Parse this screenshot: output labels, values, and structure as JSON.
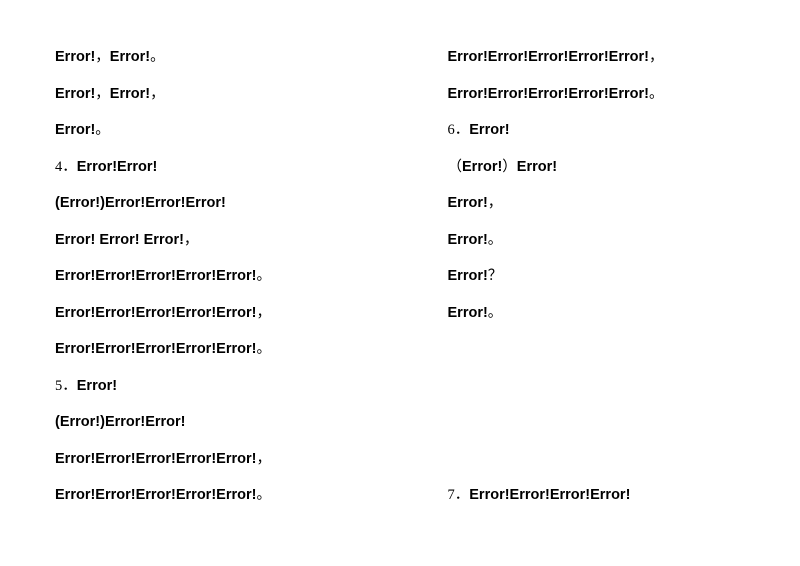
{
  "left": [
    {
      "segments": [
        {
          "t": "Error!",
          "b": true
        },
        {
          "t": "，",
          "b": false
        },
        {
          "t": "Error!",
          "b": true
        },
        {
          "t": "。",
          "b": false
        }
      ]
    },
    {
      "segments": [
        {
          "t": "Error!",
          "b": true
        },
        {
          "t": "，",
          "b": false
        },
        {
          "t": "Error!",
          "b": true
        },
        {
          "t": "，",
          "b": false
        }
      ]
    },
    {
      "segments": [
        {
          "t": "Error!",
          "b": true
        },
        {
          "t": "。",
          "b": false
        }
      ]
    },
    {
      "segments": [
        {
          "t": "4．",
          "b": false,
          "num": true
        },
        {
          "t": "Error!Error!",
          "b": true
        }
      ]
    },
    {
      "segments": [
        {
          "t": "(Error!)Error!Error!Error!",
          "b": true
        }
      ]
    },
    {
      "segments": [
        {
          "t": "Error!  Error!  Error!",
          "b": true
        },
        {
          "t": "，",
          "b": false
        }
      ]
    },
    {
      "segments": [
        {
          "t": "Error!Error!Error!Error!Error!",
          "b": true
        },
        {
          "t": "。",
          "b": false
        }
      ]
    },
    {
      "segments": [
        {
          "t": "Error!Error!Error!Error!Error!",
          "b": true
        },
        {
          "t": "，",
          "b": false
        }
      ]
    },
    {
      "segments": [
        {
          "t": "Error!Error!Error!Error!Error!",
          "b": true
        },
        {
          "t": "。",
          "b": false
        }
      ]
    },
    {
      "segments": [
        {
          "t": "5．",
          "b": false,
          "num": true
        },
        {
          "t": "Error!",
          "b": true
        }
      ]
    },
    {
      "segments": [
        {
          "t": "(Error!)Error!Error!",
          "b": true
        }
      ]
    },
    {
      "segments": [
        {
          "t": "Error!Error!Error!Error!Error!",
          "b": true
        },
        {
          "t": "，",
          "b": false
        }
      ]
    },
    {
      "segments": [
        {
          "t": "Error!Error!Error!Error!Error!",
          "b": true
        },
        {
          "t": "。",
          "b": false
        }
      ]
    }
  ],
  "right": [
    {
      "segments": [
        {
          "t": "Error!Error!Error!Error!Error!",
          "b": true
        },
        {
          "t": "，",
          "b": false
        }
      ]
    },
    {
      "segments": [
        {
          "t": "Error!Error!Error!Error!Error!",
          "b": true
        },
        {
          "t": "。",
          "b": false
        }
      ]
    },
    {
      "segments": [
        {
          "t": "6．",
          "b": false,
          "num": true
        },
        {
          "t": "Error!",
          "b": true
        }
      ]
    },
    {
      "segments": [
        {
          "t": "（",
          "b": false
        },
        {
          "t": "Error!",
          "b": true
        },
        {
          "t": "）",
          "b": false
        },
        {
          "t": "Error!",
          "b": true
        }
      ]
    },
    {
      "segments": [
        {
          "t": "Error!",
          "b": true
        },
        {
          "t": "，",
          "b": false
        }
      ]
    },
    {
      "segments": [
        {
          "t": "Error!",
          "b": true
        },
        {
          "t": "。",
          "b": false
        }
      ]
    },
    {
      "segments": [
        {
          "t": "Error!",
          "b": true
        },
        {
          "t": "？",
          "b": false
        }
      ]
    },
    {
      "segments": [
        {
          "t": "Error!",
          "b": true
        },
        {
          "t": "。",
          "b": false
        }
      ]
    },
    {
      "segments": []
    },
    {
      "segments": []
    },
    {
      "segments": []
    },
    {
      "segments": []
    },
    {
      "segments": [
        {
          "t": "7．",
          "b": false,
          "num": true
        },
        {
          "t": "Error!Error!Error!Error!",
          "b": true
        }
      ]
    }
  ]
}
